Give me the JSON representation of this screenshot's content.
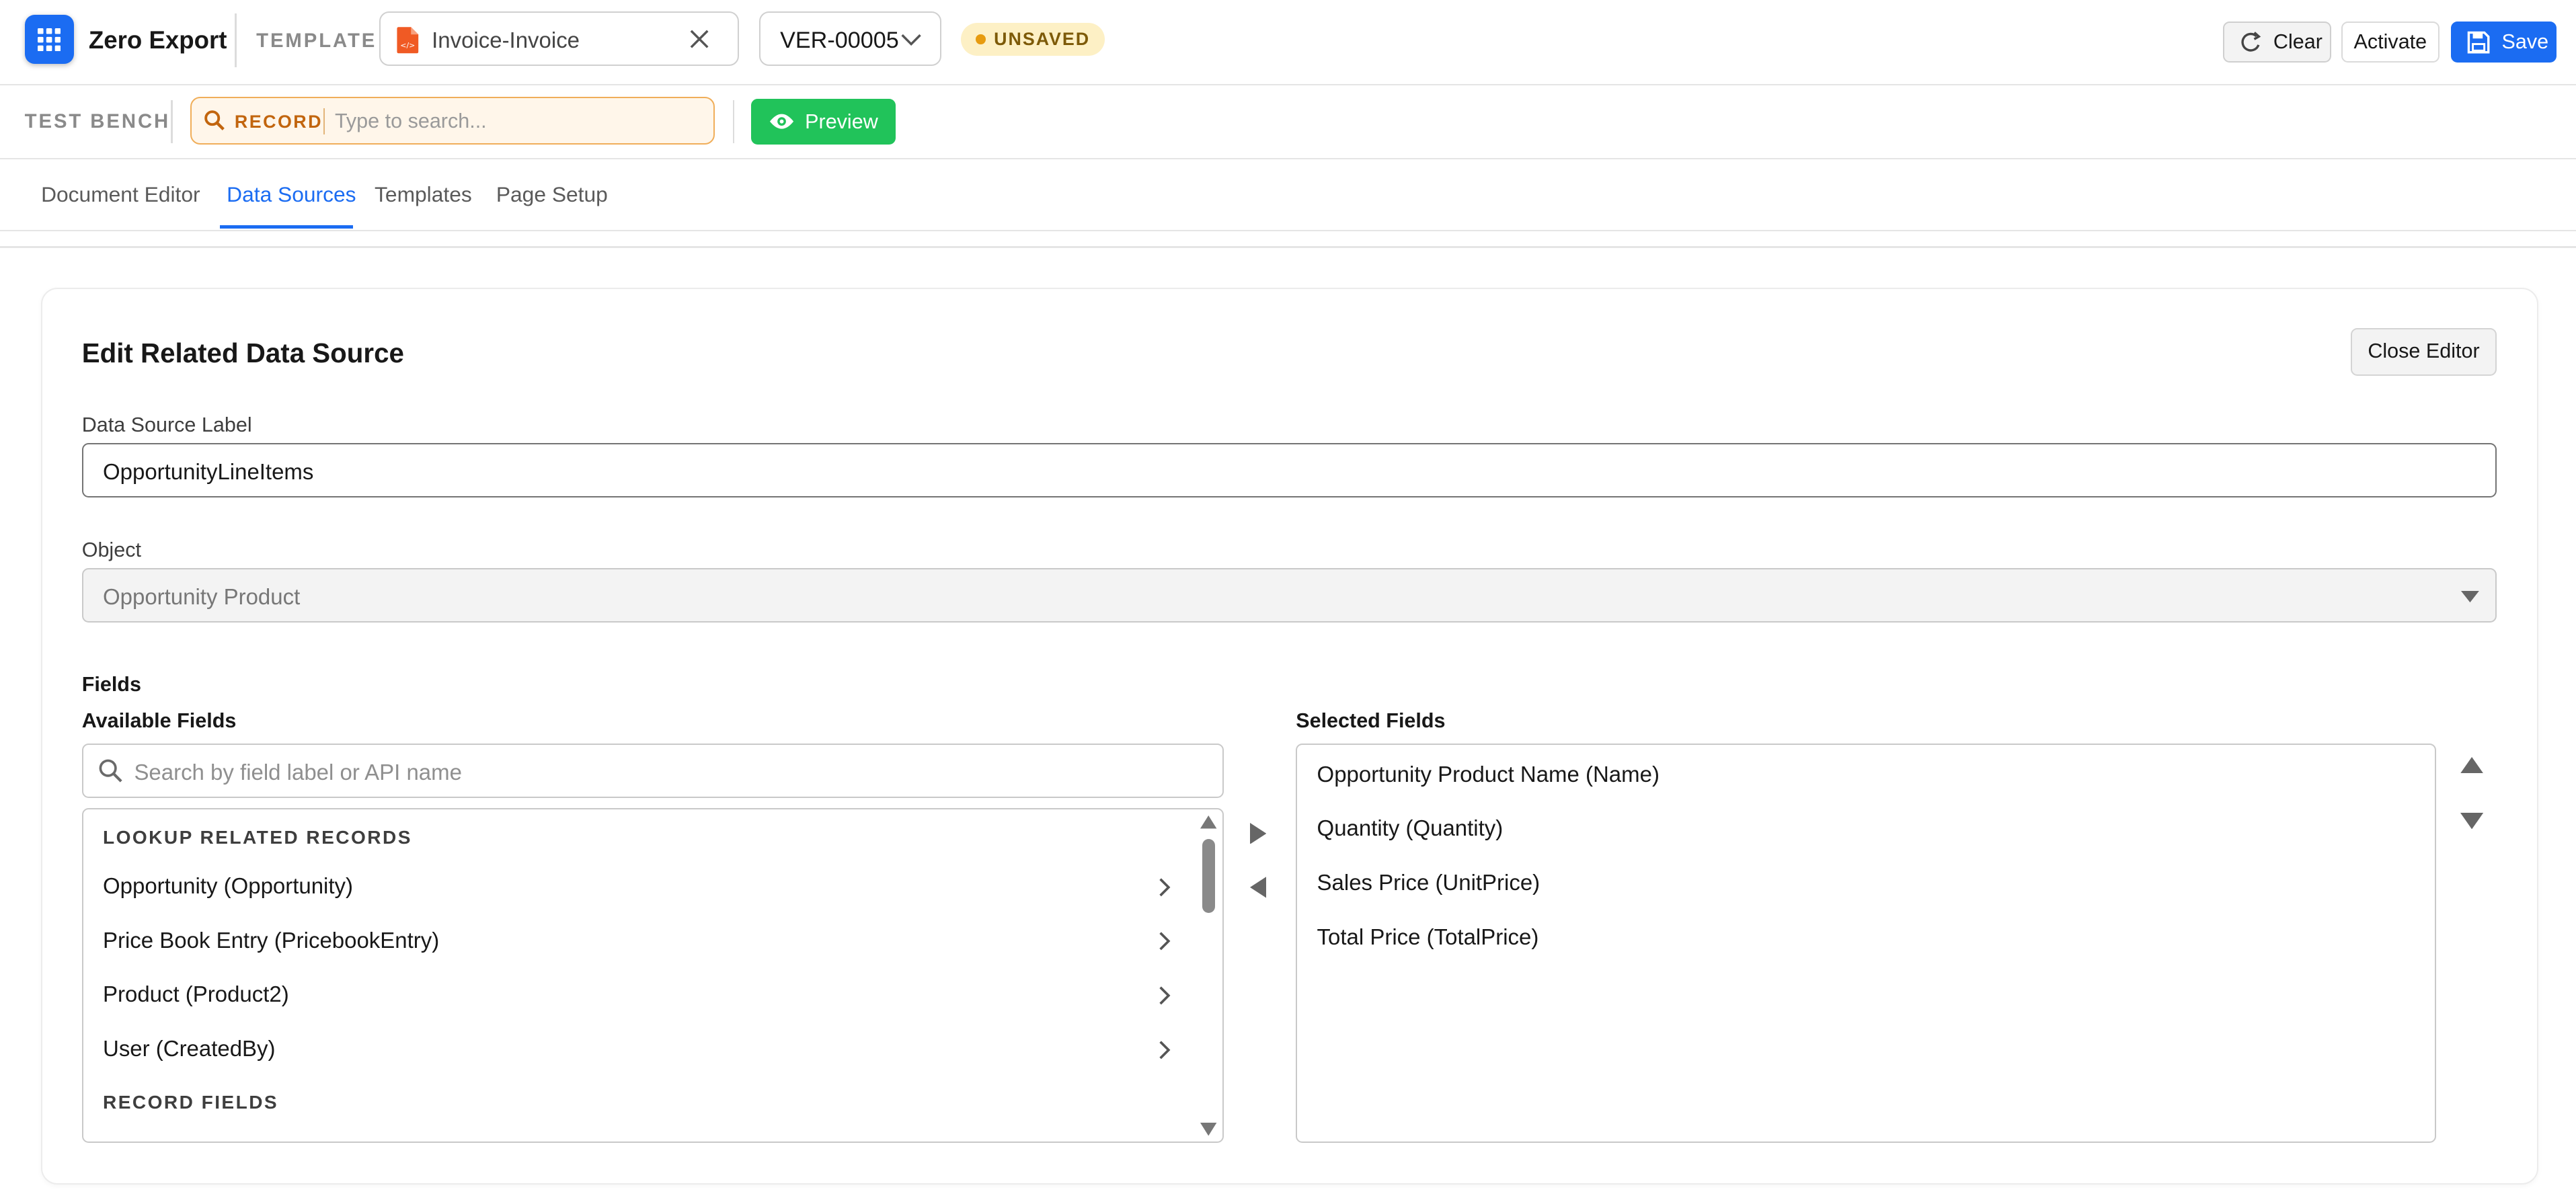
{
  "header": {
    "app_name": "Zero Export",
    "template_label": "TEMPLATE",
    "template_name": "Invoice-Invoice",
    "version": "VER-00005",
    "status": "UNSAVED",
    "clear_label": "Clear",
    "activate_label": "Activate",
    "save_label": "Save"
  },
  "test_bench": {
    "label": "TEST BENCH",
    "record_tag": "RECORD",
    "search_placeholder": "Type to search...",
    "preview_label": "Preview"
  },
  "tabs": [
    {
      "label": "Document Editor",
      "active": false
    },
    {
      "label": "Data Sources",
      "active": true
    },
    {
      "label": "Templates",
      "active": false
    },
    {
      "label": "Page Setup",
      "active": false
    }
  ],
  "editor": {
    "title": "Edit Related Data Source",
    "close_label": "Close Editor",
    "label_field": {
      "label": "Data Source Label",
      "value": "OpportunityLineItems"
    },
    "object_field": {
      "label": "Object",
      "value": "Opportunity Product"
    },
    "fields_heading": "Fields",
    "available": {
      "heading": "Available Fields",
      "search_placeholder": "Search by field label or API name",
      "sections": [
        {
          "title": "LOOKUP RELATED RECORDS",
          "items": [
            "Opportunity (Opportunity)",
            "Price Book Entry (PricebookEntry)",
            "Product (Product2)",
            "User (CreatedBy)"
          ]
        },
        {
          "title": "RECORD FIELDS",
          "items": []
        }
      ]
    },
    "selected": {
      "heading": "Selected Fields",
      "items": [
        "Opportunity Product Name (Name)",
        "Quantity (Quantity)",
        "Sales Price (UnitPrice)",
        "Total Price (TotalPrice)"
      ]
    }
  },
  "colors": {
    "accent": "#1b6cf2",
    "preview": "#21c35a",
    "unsaved_bg": "#fdf0c5",
    "record_border": "#f0ae5a"
  }
}
